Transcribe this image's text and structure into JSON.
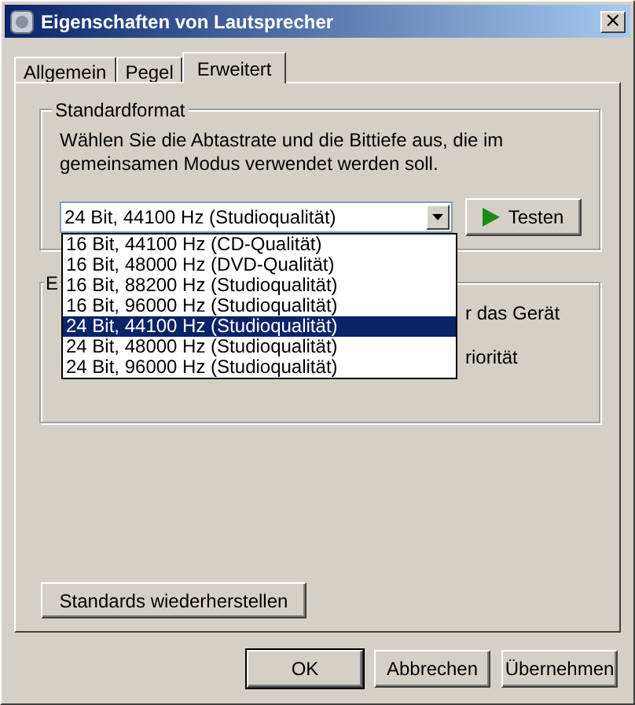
{
  "window": {
    "title": "Eigenschaften von Lautsprecher",
    "close": "×"
  },
  "tabs": [
    {
      "label": "Allgemein",
      "selected": false
    },
    {
      "label": "Pegel",
      "selected": false
    },
    {
      "label": "Erweitert",
      "selected": true
    }
  ],
  "standard_format": {
    "title": "Standardformat",
    "description": "Wählen Sie die Abtastrate und die Bittiefe aus, die im gemeinsamen Modus verwendet werden soll.",
    "value": "24 Bit, 44100 Hz (Studioqualität)",
    "test_button": "Testen",
    "options": [
      {
        "label": "16 Bit, 44100 Hz (CD-Qualität)",
        "selected": false
      },
      {
        "label": "16 Bit, 48000 Hz (DVD-Qualität)",
        "selected": false
      },
      {
        "label": "16 Bit, 88200 Hz (Studioqualität)",
        "selected": false
      },
      {
        "label": "16 Bit, 96000 Hz (Studioqualität)",
        "selected": false
      },
      {
        "label": "24 Bit, 44100 Hz (Studioqualität)",
        "selected": true
      },
      {
        "label": "24 Bit, 48000 Hz (Studioqualität)",
        "selected": false
      },
      {
        "label": "24 Bit, 96000 Hz (Studioqualität)",
        "selected": false
      }
    ]
  },
  "second_group": {
    "title": "E",
    "lines": [
      "r das Gerät",
      "riorität"
    ]
  },
  "restore_button": "Standards wiederherstellen",
  "buttons": [
    {
      "label": "OK",
      "kind": "default"
    },
    {
      "label": "Abbrechen",
      "kind": "normal"
    },
    {
      "label": "Übernehmen",
      "kind": "normal"
    }
  ]
}
